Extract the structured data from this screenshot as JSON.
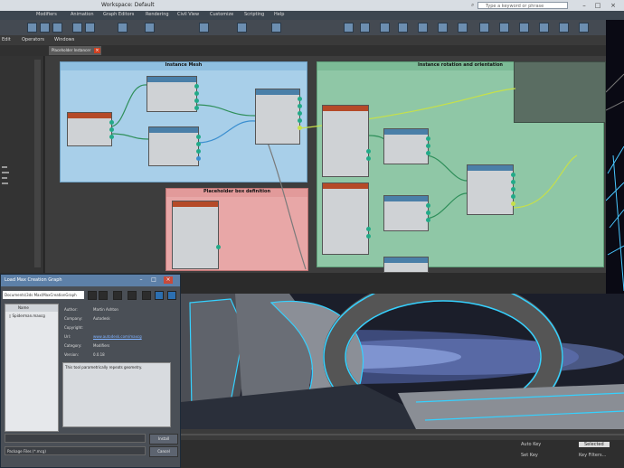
{
  "app": {
    "title": "Workspace: Default",
    "search_placeholder": "Type a keyword or phrase"
  },
  "menus": [
    "Modifiers",
    "Animation",
    "Graph Editors",
    "Rendering",
    "Civil View",
    "Customize",
    "Scripting",
    "Help"
  ],
  "submenu": [
    "Edit",
    "Operators",
    "Windows"
  ],
  "tab": {
    "label": "Placeholder Instancer"
  },
  "canvas": {
    "groups": [
      {
        "title": "Instance Mesh",
        "color": "#a8cfe9"
      },
      {
        "title": "Instance rotation and orientation",
        "color": "#8fc7a6"
      },
      {
        "title": "Placeholder box definition",
        "color": "#e8a7a7"
      }
    ]
  },
  "dialog": {
    "title": "Load Max Creation Graph",
    "path": "Documents\\3ds Max\\MaxCreationGraph",
    "tree_header": "Name",
    "tree_item": "Spiderman.maxcg",
    "info": [
      {
        "k": "Author:",
        "v": "Martin Ashton"
      },
      {
        "k": "Company:",
        "v": "Autodesk"
      },
      {
        "k": "Copyright:",
        "v": ""
      },
      {
        "k": "Url:",
        "v": "www.autodesk.com/maxcg"
      },
      {
        "k": "Category:",
        "v": "Modifiers"
      },
      {
        "k": "Version:",
        "v": "0.0.18"
      }
    ],
    "description": "This tool parametrically repeats geometry.",
    "filename_label": "",
    "filetype_label": "Package Files (*.mcg)",
    "open_button": "Install",
    "cancel_button": "Cancel"
  },
  "status": {
    "auto_key": "Auto Key",
    "set_key": "Set Key",
    "selected": "Selected",
    "key_filters": "Key Filters..."
  },
  "colors": {
    "accent": "#5d80a8",
    "node_green": "#3fa86b",
    "node_blue": "#4a7fa8",
    "node_red": "#b54a28"
  }
}
